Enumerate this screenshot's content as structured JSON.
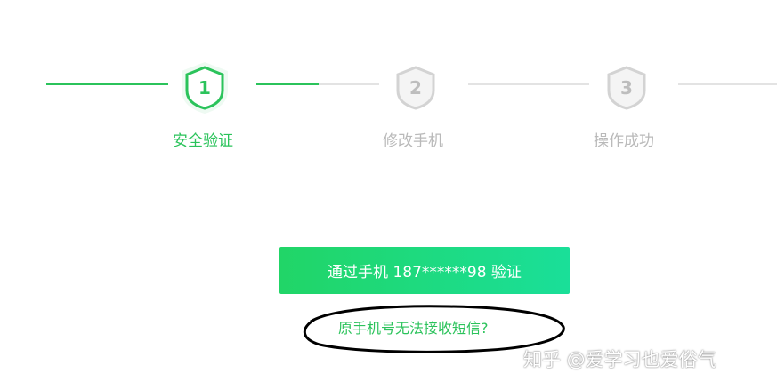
{
  "colors": {
    "accent": "#2bc35b",
    "inactive": "#b9b9b9",
    "button_start": "#21d567",
    "button_end": "#1adf99"
  },
  "steps": [
    {
      "number": "1",
      "label": "安全验证",
      "state": "active",
      "icon": "shield-icon"
    },
    {
      "number": "2",
      "label": "修改手机",
      "state": "inactive",
      "icon": "shield-icon"
    },
    {
      "number": "3",
      "label": "操作成功",
      "state": "inactive",
      "icon": "shield-icon"
    }
  ],
  "verify_button": {
    "label": "通过手机 187******98 验证"
  },
  "alt_link": {
    "label": "原手机号无法接收短信?"
  },
  "watermark": {
    "text": "知乎 @爱学习也爱俗气"
  }
}
